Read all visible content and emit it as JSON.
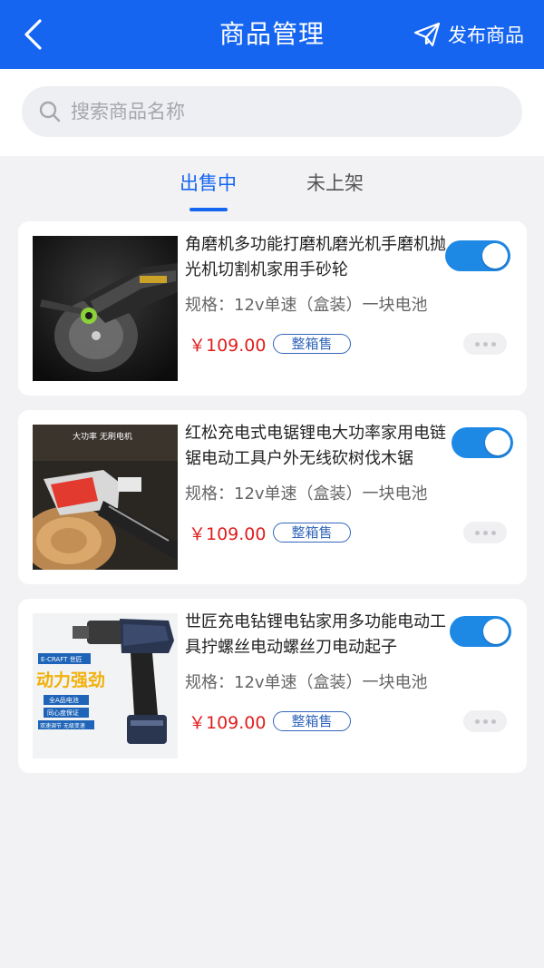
{
  "header": {
    "title": "商品管理",
    "back_icon": "chevron-left-icon",
    "publish_icon": "paper-plane-icon",
    "publish_label": "发布商品"
  },
  "search": {
    "icon": "search-icon",
    "placeholder": "搜索商品名称"
  },
  "tabs": [
    {
      "label": "出售中",
      "active": true
    },
    {
      "label": "未上架",
      "active": false
    }
  ],
  "products": [
    {
      "name": "角磨机多功能打磨机磨光机手磨机抛光机切割机家用手砂轮",
      "spec": "规格：12v单速（盒装）一块电池",
      "price": "￥109.00",
      "tag": "整箱售",
      "on_sale": true
    },
    {
      "name": "红松充电式电锯锂电大功率家用电链锯电动工具户外无线砍树伐木锯",
      "spec": "规格：12v单速（盒装）一块电池",
      "price": "￥109.00",
      "tag": "整箱售",
      "on_sale": true,
      "image_text": "大功率 无刷电机"
    },
    {
      "name": "世匠充电钻锂电钻家用多功能电动工具拧螺丝电动螺丝刀电动起子",
      "spec": "规格：12v单速（盒装）一块电池",
      "price": "￥109.00",
      "tag": "整箱售",
      "on_sale": true,
      "image_text": {
        "brand": "E-CRAFT 世匠",
        "slogan": "动力强劲",
        "badge1": "全A品电池",
        "badge2": "同心度保证",
        "badge3": "双速调节 无级变速"
      }
    }
  ],
  "colors": {
    "primary": "#1565f0",
    "price": "#e01e1e",
    "toggle_on": "#1e88e5",
    "tag_border": "#3366bb"
  }
}
